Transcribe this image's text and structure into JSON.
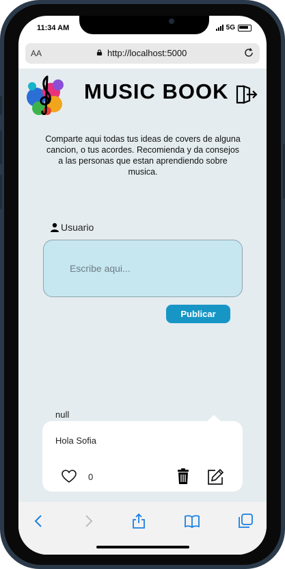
{
  "status": {
    "time": "11:34 AM",
    "network": "5G"
  },
  "browser": {
    "text_size_label": "AA",
    "url": "http://localhost:5000"
  },
  "header": {
    "title": "MUSIC BOOK"
  },
  "intro": {
    "text": "Comparte aqui todas tus ideas de covers de alguna cancion, o tus acordes. Recomienda y da consejos a las personas que estan aprendiendo sobre musica."
  },
  "composer": {
    "user_label": "Usuario",
    "placeholder": "Escribe aqui...",
    "value": "",
    "publish_label": "Publicar"
  },
  "posts": [
    {
      "author": "null",
      "text": "Hola Sofia",
      "likes": "0"
    }
  ],
  "icons": [
    "treble-clef-logo-icon",
    "logout-icon",
    "user-icon",
    "heart-icon",
    "trash-icon",
    "edit-icon",
    "lock-icon",
    "reload-icon",
    "back-icon",
    "forward-icon",
    "share-icon",
    "bookmarks-icon",
    "tabs-icon"
  ],
  "colors": {
    "page_bg": "#e4ecef",
    "input_bg": "#c6e6f0",
    "accent": "#1796c6",
    "toolbar_icons": "#1a7ee0"
  }
}
